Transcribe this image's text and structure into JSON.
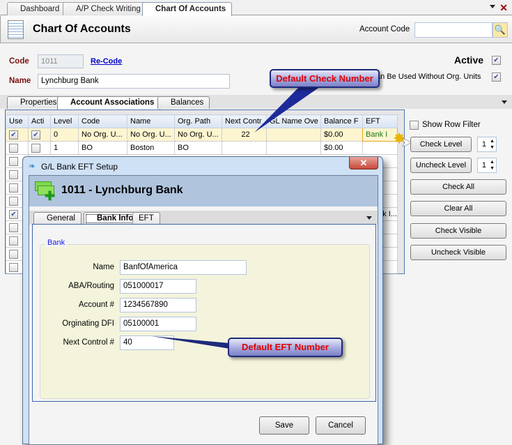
{
  "doc_tabs": [
    {
      "label": "Dashboard"
    },
    {
      "label": "A/P Check Writing"
    },
    {
      "label": "Chart Of Accounts",
      "active": true
    }
  ],
  "header": {
    "title": "Chart Of Accounts",
    "account_code_label": "Account Code",
    "account_code_value": ""
  },
  "form": {
    "code_label": "Code",
    "code_value": "1011",
    "recode_link": "Re-Code",
    "name_label": "Name",
    "name_value": "Lynchburg Bank",
    "active_label": "Active",
    "active_checked": true,
    "can_be_used_label": "an Be Used Without Org. Units",
    "can_be_used_checked": true
  },
  "sub_tabs": [
    {
      "label": "Properties"
    },
    {
      "label": "Account Associations",
      "active": true
    },
    {
      "label": "Balances"
    }
  ],
  "grid": {
    "columns": [
      "Use",
      "Acti",
      "Level",
      "Code",
      "Name",
      "Org. Path",
      "Next Contr",
      "GL Name Ove",
      "Balance F",
      "EFT"
    ],
    "rows": [
      {
        "use": true,
        "acti": true,
        "level": "0",
        "code": "No Org. U...",
        "name": "No Org. U...",
        "org_path": "No Org. U...",
        "next_control": "22",
        "gl_name": "",
        "balance": "$0.00",
        "eft": "Bank I"
      },
      {
        "use": false,
        "acti": false,
        "level": "1",
        "code": "BO",
        "name": "Boston",
        "org_path": "BO",
        "next_control": "",
        "gl_name": "",
        "balance": "$0.00",
        "eft": ""
      }
    ],
    "hidden_row_eft_fragment": "k I..."
  },
  "right_panel": {
    "show_row_filter": "Show Row Filter",
    "check_level": "Check Level",
    "check_level_value": "1",
    "uncheck_level": "Uncheck Level",
    "uncheck_level_value": "1",
    "check_all": "Check All",
    "clear_all": "Clear All",
    "check_visible": "Check Visible",
    "uncheck_visible": "Uncheck Visible"
  },
  "callouts": {
    "check": "Default Check Number",
    "eft": "Default EFT Number"
  },
  "dialog": {
    "title": "G/L Bank EFT Setup",
    "heading": "1011 - Lynchburg Bank",
    "tabs": [
      {
        "label": "General"
      },
      {
        "label": "Bank Info",
        "active": true
      },
      {
        "label": "EFT"
      }
    ],
    "group_label": "Bank",
    "fields": [
      {
        "label": "Name",
        "value": "BanfOfAmerica"
      },
      {
        "label": "ABA/Routing",
        "value": "051000017"
      },
      {
        "label": "Account #",
        "value": "1234567890"
      },
      {
        "label": "Orginating DFI",
        "value": "05100001"
      },
      {
        "label": "Next Control #",
        "value": "40"
      }
    ],
    "save": "Save",
    "cancel": "Cancel"
  }
}
